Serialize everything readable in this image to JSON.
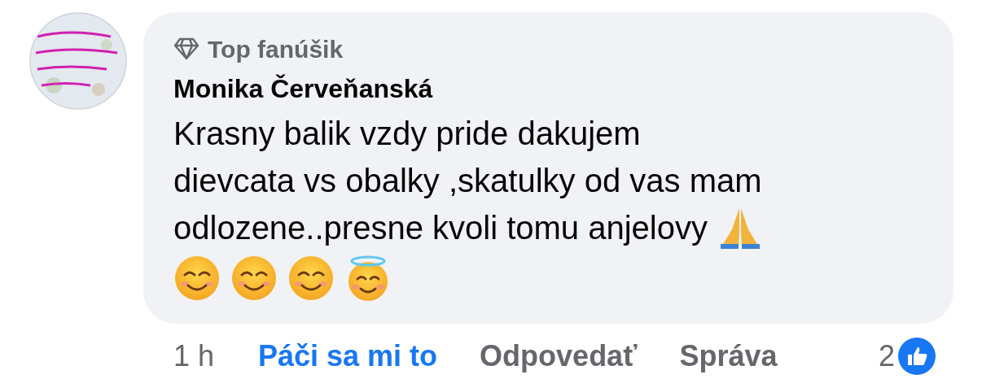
{
  "comment": {
    "badge": "Top fanúšik",
    "author": "Monika Červeňanská",
    "lines": [
      "Krasny balik vzdy pride dakujem",
      "dievcata vs obalky ,skatulky od vas mam",
      "odlozene..presne kvoli tomu anjelovy"
    ]
  },
  "actions": {
    "time": "1 h",
    "like": {
      "label": "Páči sa mi to",
      "liked": true
    },
    "reply": "Odpovedať",
    "message": "Správa",
    "reaction_count": "2"
  }
}
